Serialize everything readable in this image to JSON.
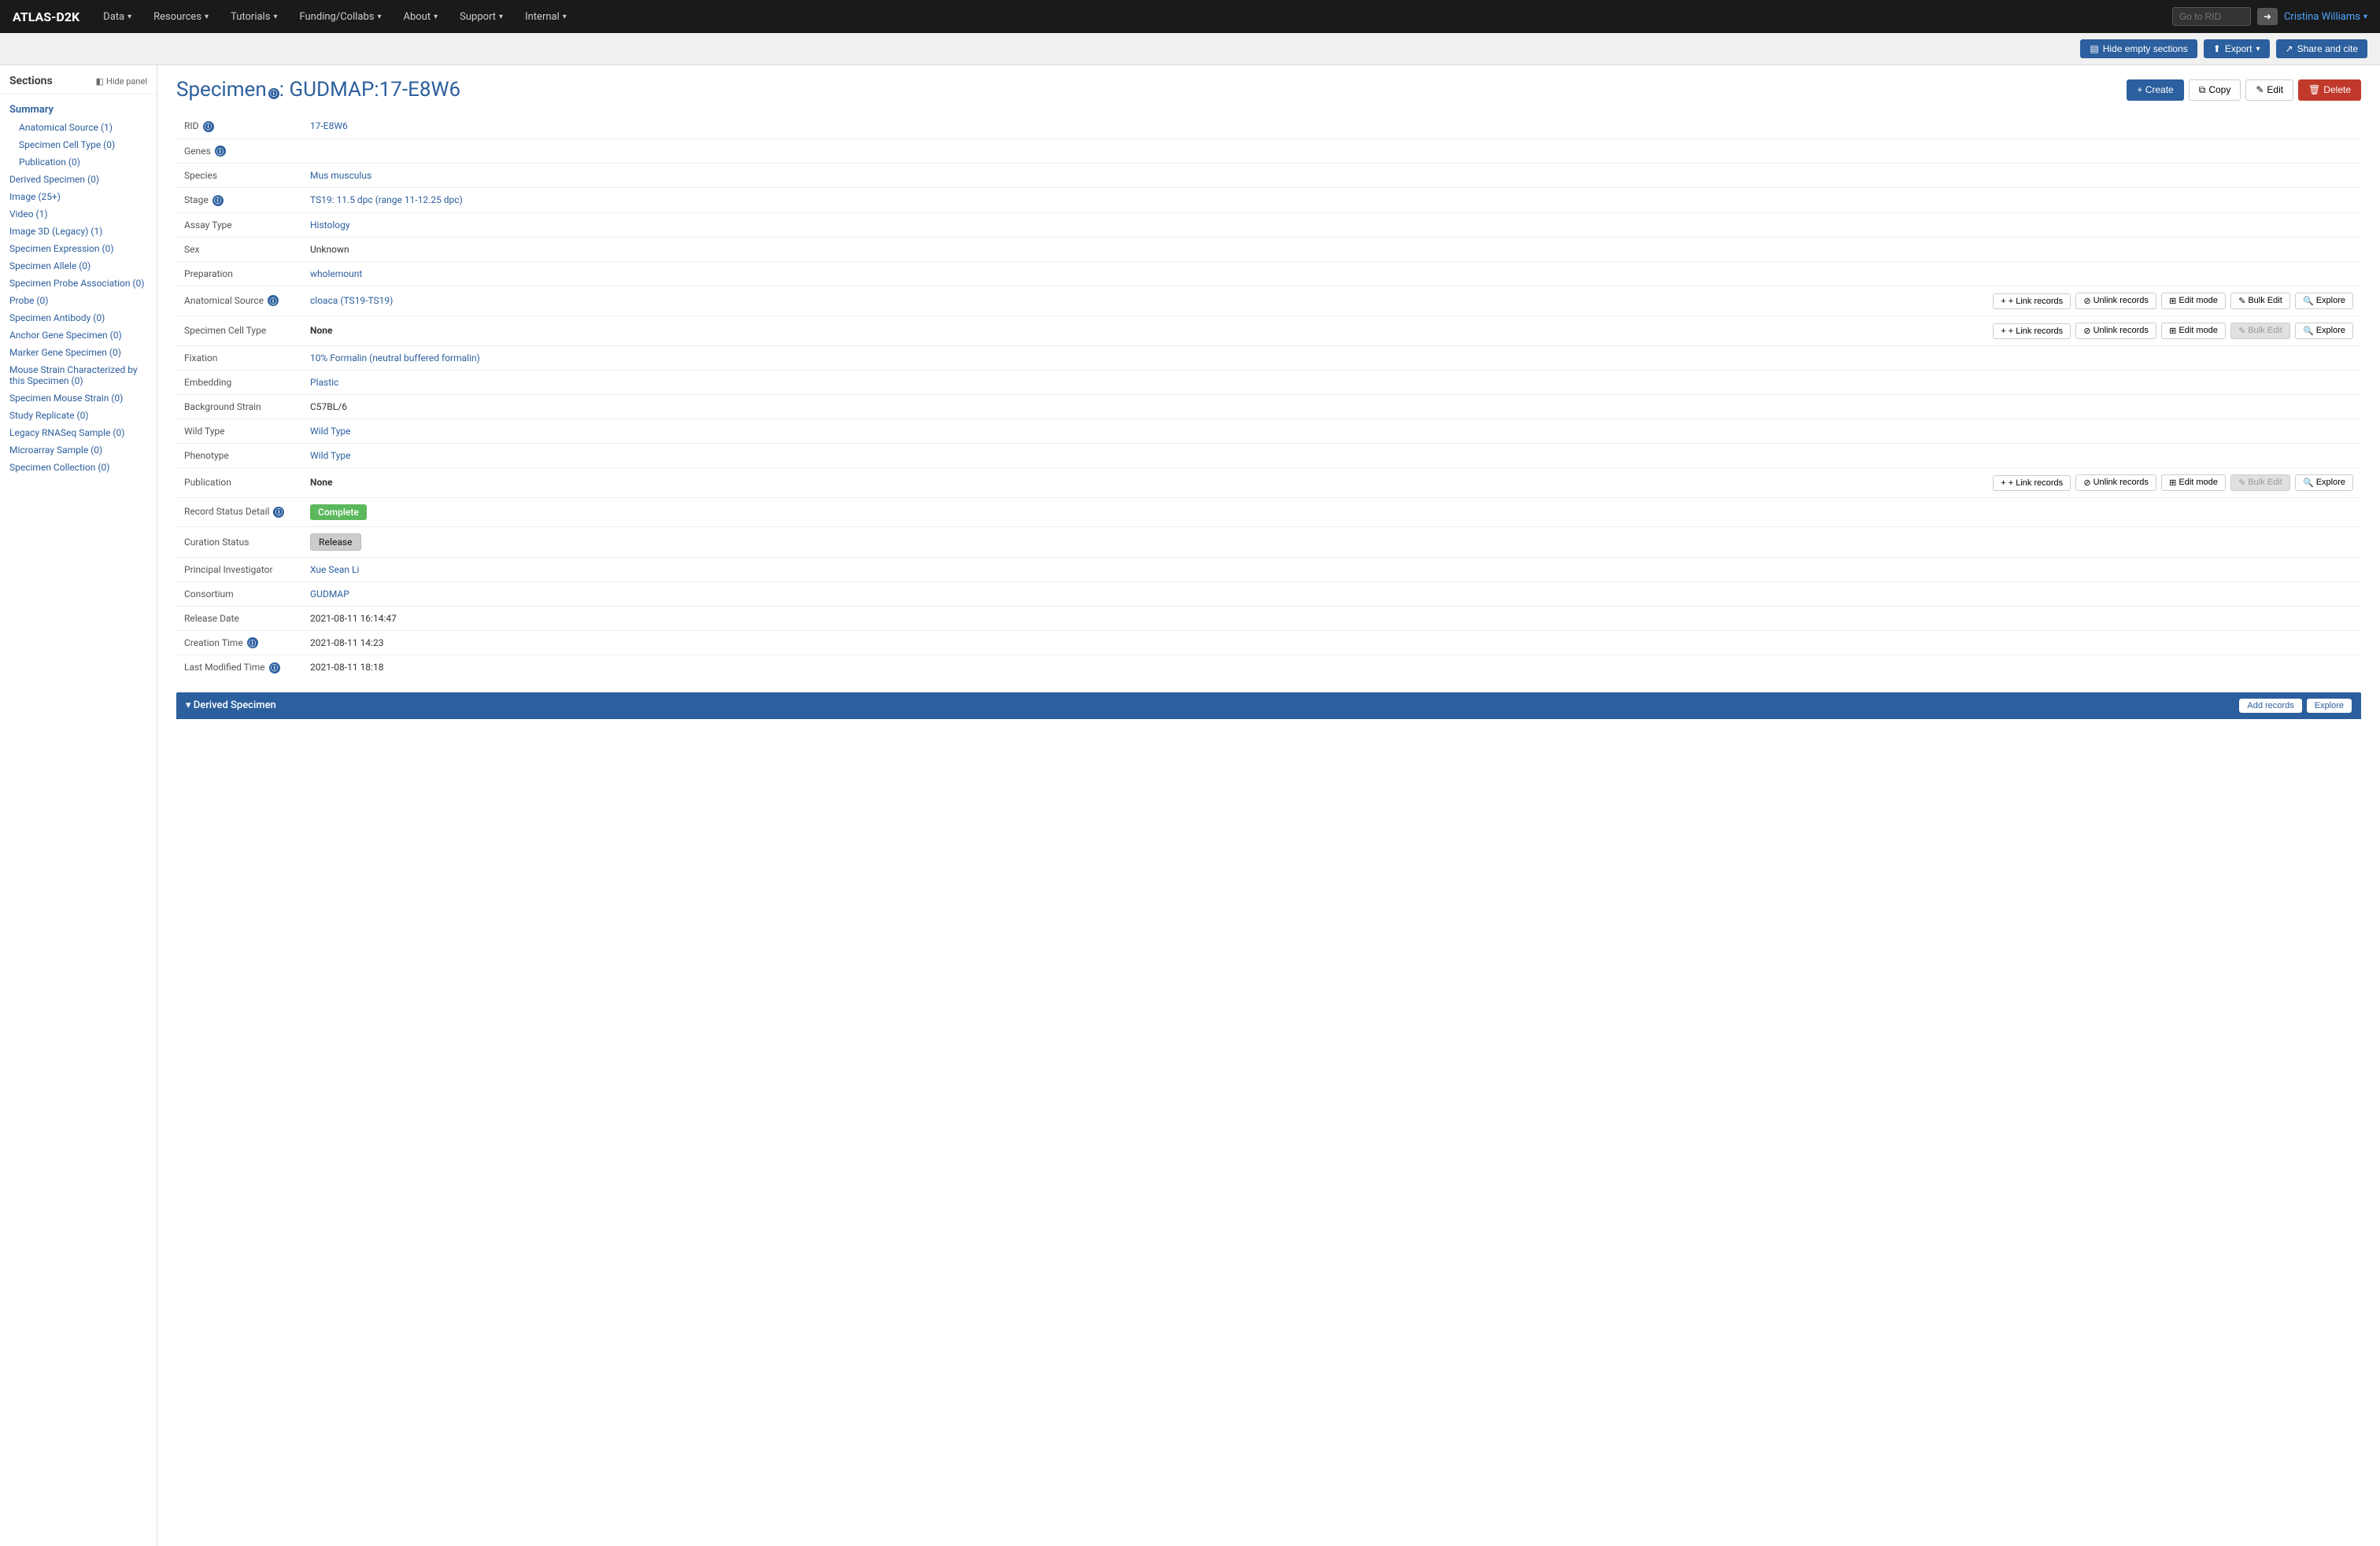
{
  "app": {
    "brand": "ATLAS-D2K"
  },
  "navbar": {
    "items": [
      {
        "label": "Data",
        "id": "data"
      },
      {
        "label": "Resources",
        "id": "resources"
      },
      {
        "label": "Tutorials",
        "id": "tutorials"
      },
      {
        "label": "Funding/Collabs",
        "id": "funding"
      },
      {
        "label": "About",
        "id": "about"
      },
      {
        "label": "Support",
        "id": "support"
      },
      {
        "label": "Internal",
        "id": "internal"
      }
    ],
    "goto_placeholder": "Go to RID",
    "user": "Cristina Williams"
  },
  "subtoolbar": {
    "hide_empty": "Hide empty sections",
    "export": "Export",
    "share": "Share and cite"
  },
  "sidebar": {
    "title": "Sections",
    "hide_panel": "Hide panel",
    "items": [
      {
        "label": "Summary",
        "active": true,
        "indent": false
      },
      {
        "label": "Anatomical Source (1)",
        "indent": true
      },
      {
        "label": "Specimen Cell Type (0)",
        "indent": true
      },
      {
        "label": "Publication (0)",
        "indent": true
      },
      {
        "label": "Derived Specimen (0)",
        "indent": false
      },
      {
        "label": "Image (25+)",
        "indent": false
      },
      {
        "label": "Video (1)",
        "indent": false
      },
      {
        "label": "Image 3D (Legacy) (1)",
        "indent": false
      },
      {
        "label": "Specimen Expression (0)",
        "indent": false
      },
      {
        "label": "Specimen Allele (0)",
        "indent": false
      },
      {
        "label": "Specimen Probe Association (0)",
        "indent": false
      },
      {
        "label": "Probe (0)",
        "indent": false
      },
      {
        "label": "Specimen Antibody (0)",
        "indent": false
      },
      {
        "label": "Anchor Gene Specimen (0)",
        "indent": false
      },
      {
        "label": "Marker Gene Specimen (0)",
        "indent": false
      },
      {
        "label": "Mouse Strain Characterized by this Specimen (0)",
        "indent": false
      },
      {
        "label": "Specimen Mouse Strain (0)",
        "indent": false
      },
      {
        "label": "Study Replicate (0)",
        "indent": false
      },
      {
        "label": "Legacy RNASeq Sample (0)",
        "indent": false
      },
      {
        "label": "Microarray Sample (0)",
        "indent": false
      },
      {
        "label": "Specimen Collection (0)",
        "indent": false
      }
    ]
  },
  "page": {
    "title": "Specimen",
    "title_info": true,
    "subtitle": "GUDMAP:17-E8W6",
    "actions": {
      "create": "+ Create",
      "copy": "Copy",
      "edit": "Edit",
      "delete": "Delete"
    }
  },
  "record": {
    "rid_label": "RID",
    "rid_value": "17-E8W6",
    "rid_info": true,
    "genes_label": "Genes",
    "genes_info": true,
    "genes_value": "",
    "species_label": "Species",
    "species_value": "Mus musculus",
    "stage_label": "Stage",
    "stage_info": true,
    "stage_value": "TS19: 11.5 dpc (range 11-12.25 dpc)",
    "assay_type_label": "Assay Type",
    "assay_type_value": "Histology",
    "sex_label": "Sex",
    "sex_value": "Unknown",
    "preparation_label": "Preparation",
    "preparation_value": "wholemount",
    "anatomical_source_label": "Anatomical Source",
    "anatomical_source_info": true,
    "anatomical_source_value": "cloaca (TS19-TS19)",
    "specimen_cell_type_label": "Specimen Cell Type",
    "specimen_cell_type_value": "None",
    "fixation_label": "Fixation",
    "fixation_value": "10% Formalin (neutral buffered formalin)",
    "embedding_label": "Embedding",
    "embedding_value": "Plastic",
    "background_strain_label": "Background Strain",
    "background_strain_value": "C57BL/6",
    "wild_type_label": "Wild Type",
    "wild_type_value": "Wild Type",
    "phenotype_label": "Phenotype",
    "phenotype_value": "Wild Type",
    "publication_label": "Publication",
    "publication_value": "None",
    "record_status_label": "Record Status Detail",
    "record_status_info": true,
    "record_status_value": "Complete",
    "curation_status_label": "Curation Status",
    "curation_status_value": "Release",
    "principal_investigator_label": "Principal Investigator",
    "principal_investigator_value": "Xue Sean Li",
    "consortium_label": "Consortium",
    "consortium_value": "GUDMAP",
    "release_date_label": "Release Date",
    "release_date_value": "2021-08-11 16:14:47",
    "creation_time_label": "Creation Time",
    "creation_time_info": true,
    "creation_time_value": "2021-08-11 14:23",
    "last_modified_label": "Last Modified Time",
    "last_modified_info": true,
    "last_modified_value": "2021-08-11 18:18"
  },
  "row_buttons": {
    "link": "+ Link records",
    "unlink": "Unlink records",
    "edit_mode": "Edit mode",
    "bulk_edit": "Bulk Edit",
    "explore": "Explore"
  },
  "derived_section": {
    "title": "Derived Specimen",
    "add": "Add records",
    "explore": "Explore"
  }
}
